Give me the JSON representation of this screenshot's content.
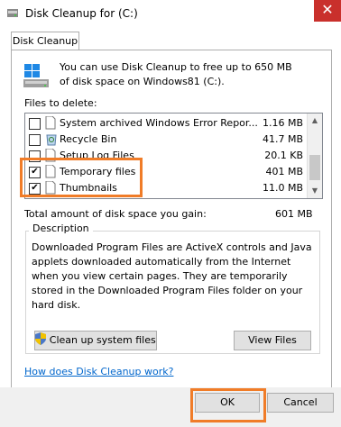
{
  "window": {
    "title": "Disk Cleanup for  (C:)"
  },
  "tab": {
    "label": "Disk Cleanup"
  },
  "intro": {
    "text": "You can use Disk Cleanup to free up to 650 MB of disk space on Windows81 (C:)."
  },
  "files_label": "Files to delete:",
  "files": [
    {
      "name": "System archived Windows Error Repor...",
      "size": "1.16 MB",
      "checked": false
    },
    {
      "name": "Recycle Bin",
      "size": "41.7 MB",
      "checked": false
    },
    {
      "name": "Setup Log Files",
      "size": "20.1 KB",
      "checked": false
    },
    {
      "name": "Temporary files",
      "size": "401 MB",
      "checked": true
    },
    {
      "name": "Thumbnails",
      "size": "11.0 MB",
      "checked": true
    }
  ],
  "total": {
    "label": "Total amount of disk space you gain:",
    "value": "601 MB"
  },
  "description": {
    "label": "Description",
    "text": "Downloaded Program Files are ActiveX controls and Java applets downloaded automatically from the Internet when you view certain pages. They are temporarily stored in the Downloaded Program Files folder on your hard disk."
  },
  "buttons": {
    "cleanup_system": "Clean up system files",
    "view_files": "View Files",
    "ok": "OK",
    "cancel": "Cancel"
  },
  "help_link": "How does Disk Cleanup work?",
  "colors": {
    "highlight": "#f07c28",
    "close": "#c9302c"
  }
}
